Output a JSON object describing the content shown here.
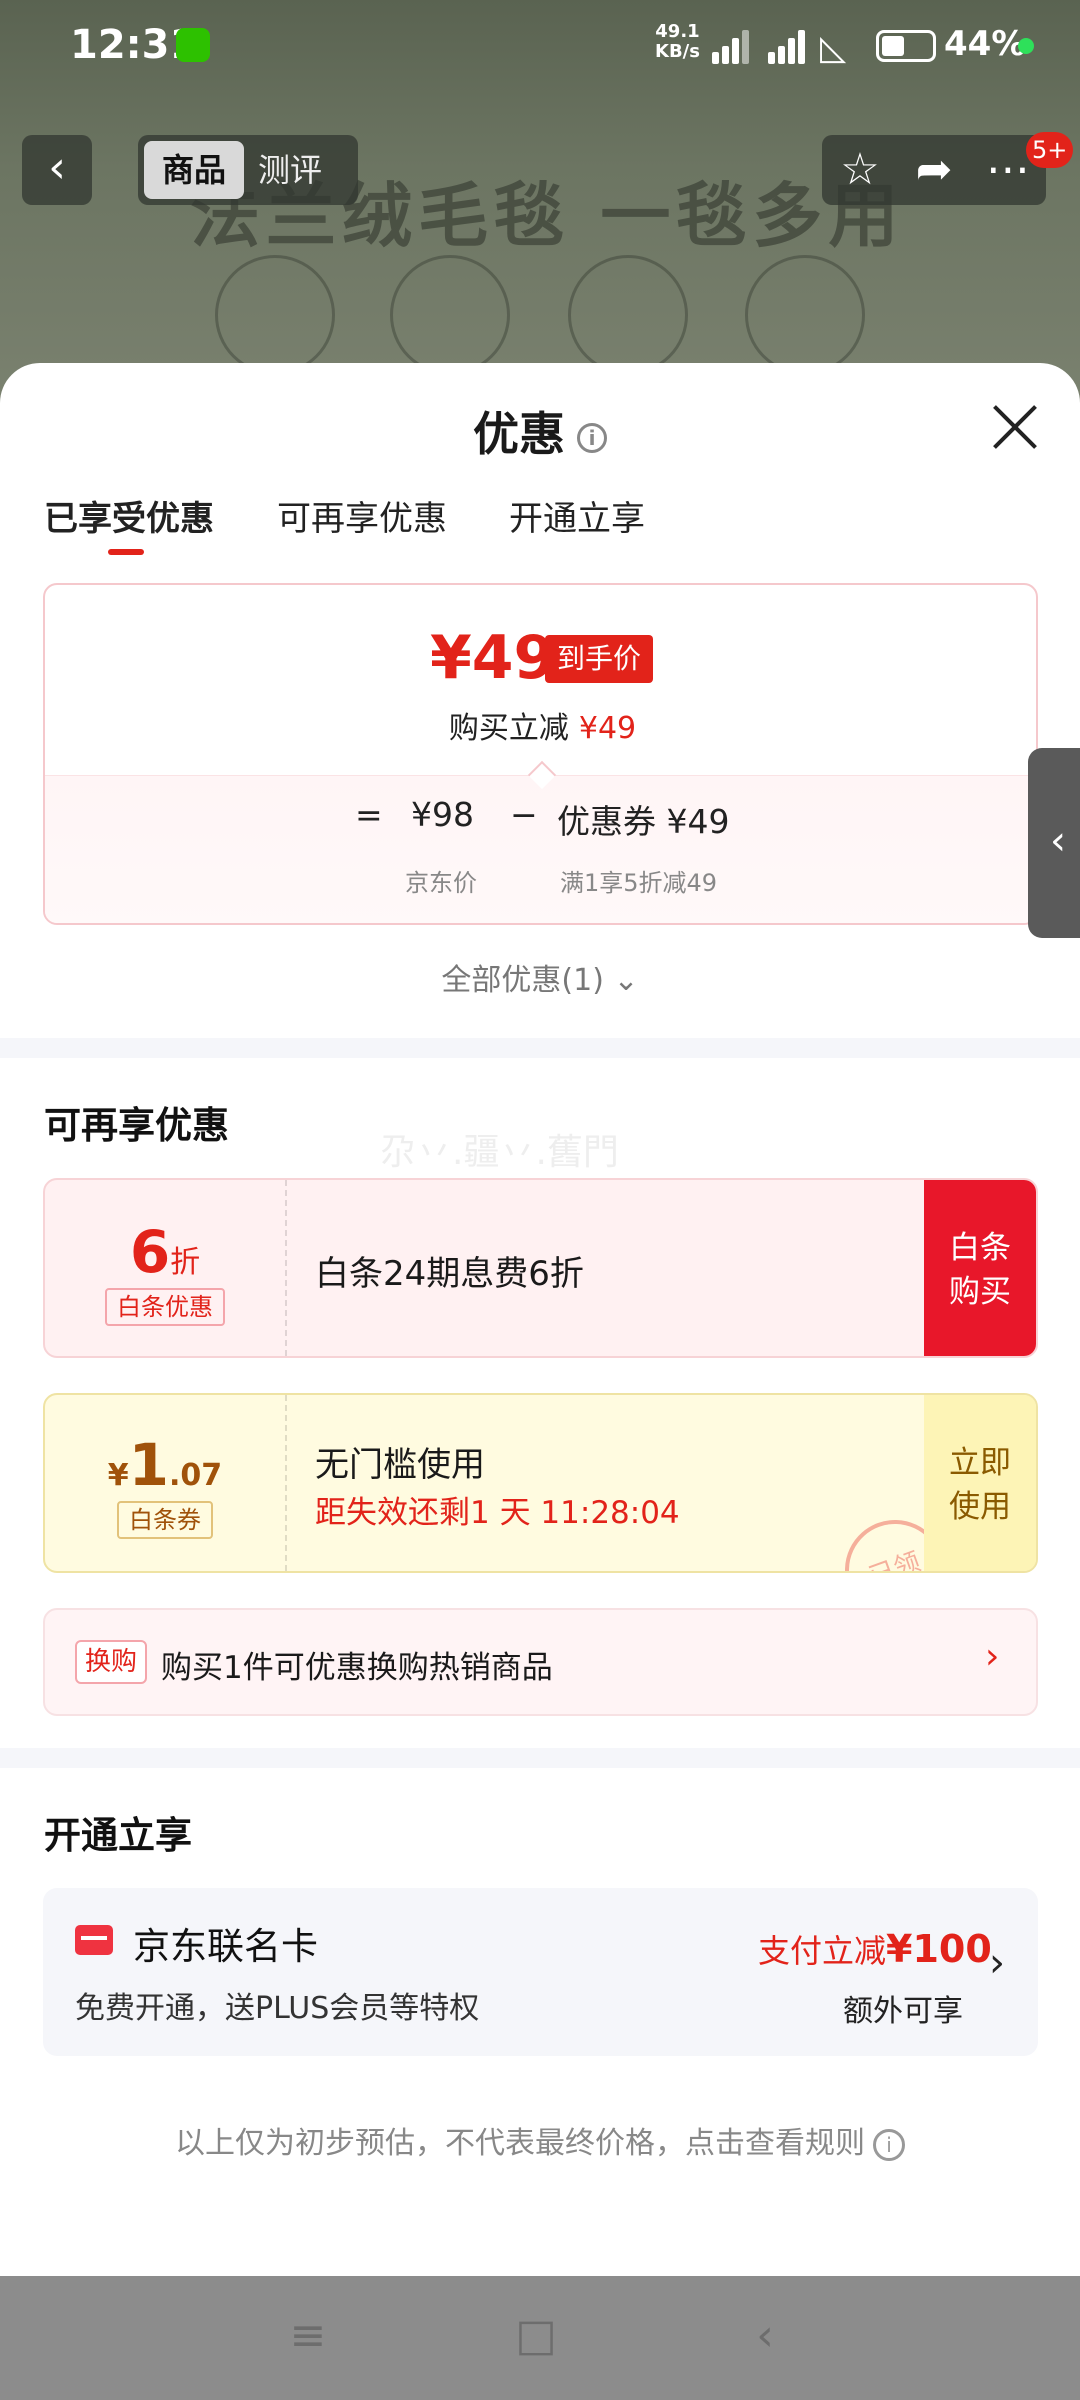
{
  "status_bar": {
    "time": "12:31",
    "net_speed_value": "49.1",
    "net_speed_unit": "KB/s",
    "battery": "44%"
  },
  "product_page": {
    "tab_product": "商品",
    "tab_review": "测评",
    "banner_text": "法兰绒毛毯 一毯多用",
    "badge": "5+"
  },
  "sheet": {
    "title": "优惠",
    "tabs": [
      "已享受优惠",
      "可再享优惠",
      "开通立享"
    ],
    "final_price": "¥49",
    "final_price_tag": "到手价",
    "reduce_label": "购买立减",
    "reduce_amount": "¥49",
    "formula": {
      "eq": "=",
      "jd_price": "¥98",
      "minus": "−",
      "coupon": "优惠券 ¥49",
      "jd_price_label": "京东价",
      "coupon_label": "满1享5折减49"
    },
    "all_discounts": "全部优惠(1)"
  },
  "more_section": {
    "title": "可再享优惠",
    "watermark": "尕丷.疆丷.舊門",
    "baitiao_offer": {
      "value": "6",
      "unit": "折",
      "tag": "白条优惠",
      "text": "白条24期息费6折",
      "button_line1": "白条",
      "button_line2": "购买"
    },
    "baitiao_coupon": {
      "currency": "¥",
      "value_int": "1",
      "value_dec": ".07",
      "tag": "白条券",
      "text": "无门槛使用",
      "countdown": "距失效还剩1 天 11:28:04",
      "button_line1": "立即",
      "button_line2": "使用",
      "stamp": "已领"
    },
    "exchange": {
      "tag": "换购",
      "text": "购买1件可优惠换购热销商品"
    }
  },
  "open_section": {
    "title": "开通立享",
    "card_name": "京东联名卡",
    "card_desc": "免费开通，送PLUS会员等特权",
    "promo_prefix": "支付立减",
    "promo_amount": "¥100",
    "extra": "额外可享"
  },
  "disclaimer": "以上仅为初步预估，不代表最终价格，点击查看规则",
  "colors": {
    "accent": "#e2231a",
    "pink_bg": "#fff1f2",
    "yellow_bg": "#fffbe0"
  }
}
